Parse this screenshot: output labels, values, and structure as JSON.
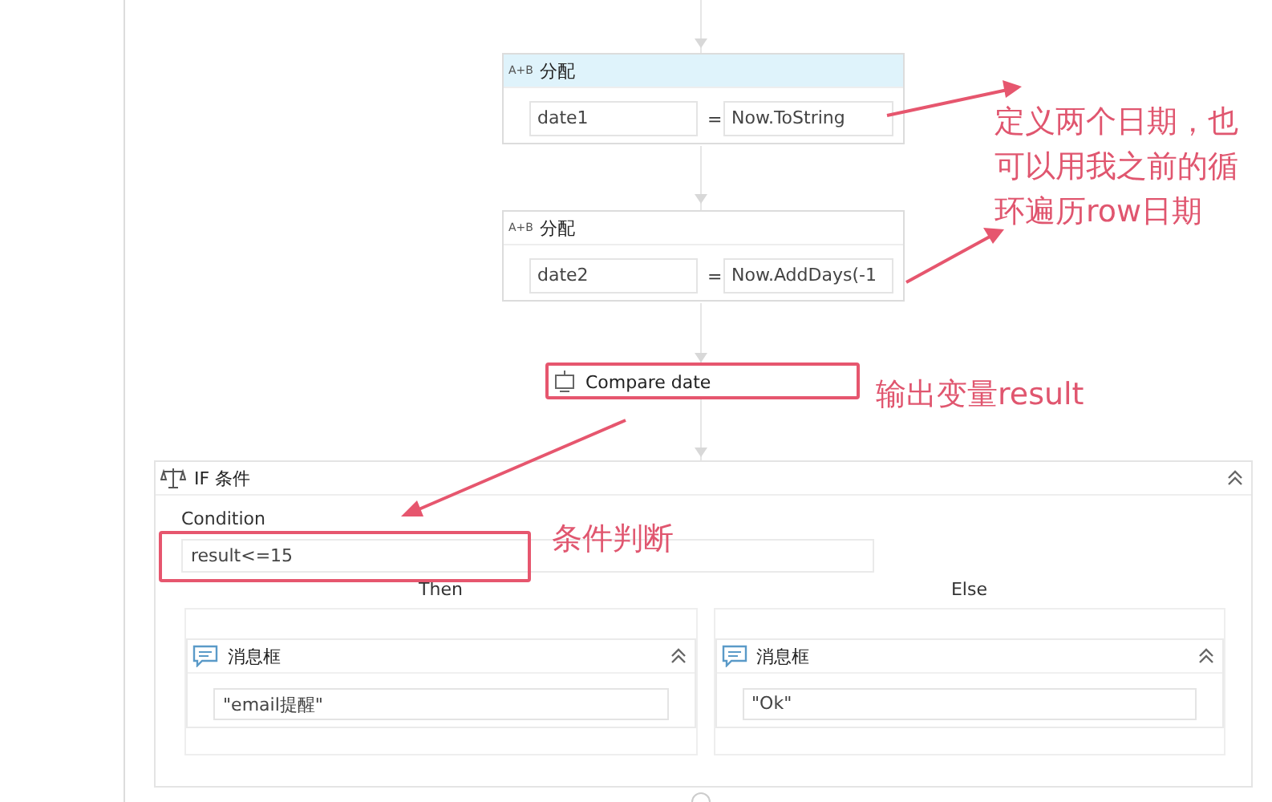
{
  "assign_blocks": [
    {
      "icon_text": "A+B",
      "title": "分配",
      "highlighted": true,
      "target": "date1",
      "operator": "=",
      "value": "Now.ToString"
    },
    {
      "icon_text": "A+B",
      "title": "分配",
      "highlighted": false,
      "target": "date2",
      "operator": "=",
      "value": "Now.AddDays(-1"
    }
  ],
  "invoke_activity": {
    "title": "Compare date"
  },
  "if_block": {
    "title": "IF 条件",
    "condition_label": "Condition",
    "condition": "result<=15",
    "branches": [
      {
        "label": "Then",
        "activity": {
          "title": "消息框",
          "text": "\"email提醒\""
        }
      },
      {
        "label": "Else",
        "activity": {
          "title": "消息框",
          "text": "\"Ok\""
        }
      }
    ]
  },
  "annotations": [
    {
      "kind": "note",
      "text": "定义两个日期，也可以用我之前的循环遍历row日期"
    },
    {
      "kind": "note",
      "text": "输出变量result"
    },
    {
      "kind": "note",
      "text": "条件判断"
    }
  ]
}
